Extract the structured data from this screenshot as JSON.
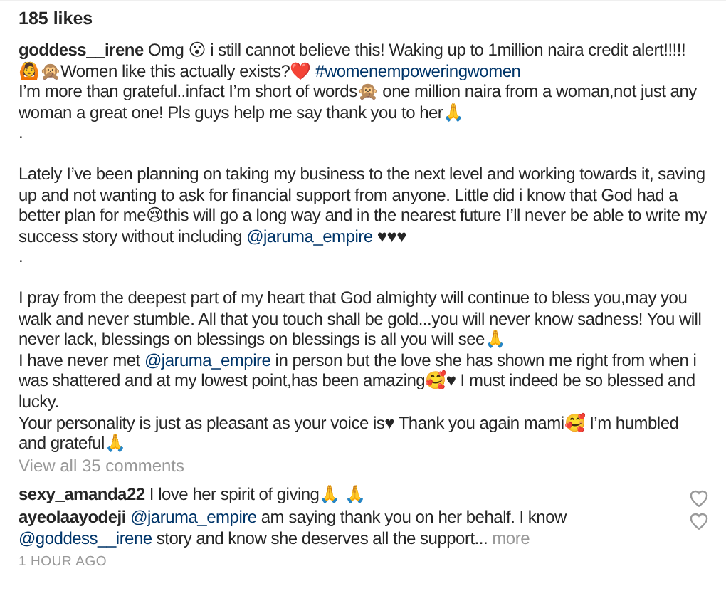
{
  "likes": "185 likes",
  "caption_blocks": [
    [
      {
        "segments": [
          {
            "kind": "username",
            "text": "goddess__irene"
          },
          {
            "kind": "text",
            "text": "Omg 😮 i still cannot believe this! Waking up to 1million naira credit alert!!!!! 🙆🙊Women like this actually exists?❤️ "
          },
          {
            "kind": "hashtag",
            "text": "#womenempoweringwomen"
          }
        ]
      },
      {
        "segments": [
          {
            "kind": "text",
            "text": "I’m more than grateful..infact I’m short of words🙊 one million naira from a woman,not just any woman a great one! Pls guys help me say thank you to her🙏"
          }
        ]
      },
      {
        "segments": [
          {
            "kind": "text",
            "text": "."
          }
        ]
      }
    ],
    [
      {
        "segments": [
          {
            "kind": "text",
            "text": "Lately I’ve been planning on taking my business to the next level and working towards it, saving up and not wanting to ask for financial support from anyone. Little did i know that God had a better plan for me😢this will go a long way and in the nearest future I’ll never be able to write my success story without including "
          },
          {
            "kind": "mention",
            "text": "@jaruma_empire"
          },
          {
            "kind": "text",
            "text": " ♥♥♥"
          }
        ]
      },
      {
        "segments": [
          {
            "kind": "text",
            "text": "."
          }
        ]
      }
    ],
    [
      {
        "segments": [
          {
            "kind": "text",
            "text": "I pray from the deepest part of my heart that God almighty will continue to bless you,may you walk and never stumble. All that you touch shall be gold...you will never know sadness! You will never lack, blessings on blessings on blessings is all you will see🙏"
          }
        ]
      },
      {
        "segments": [
          {
            "kind": "text",
            "text": "I have never met "
          },
          {
            "kind": "mention",
            "text": "@jaruma_empire"
          },
          {
            "kind": "text",
            "text": " in person but the love she has shown me right from when i was shattered and at my lowest point,has been amazing🥰♥ I must indeed be so blessed and lucky."
          }
        ]
      },
      {
        "segments": [
          {
            "kind": "text",
            "text": "Your personality is just as pleasant as your voice is♥ Thank you again mami🥰 I’m humbled and grateful🙏"
          }
        ]
      }
    ]
  ],
  "view_all": "View all 35 comments",
  "comments": [
    {
      "segments": [
        {
          "kind": "username",
          "text": "sexy_amanda22"
        },
        {
          "kind": "text",
          "text": "I love her spirit of giving🙏 🙏"
        }
      ],
      "liked": false
    },
    {
      "segments": [
        {
          "kind": "username",
          "text": "ayeolaayodeji"
        },
        {
          "kind": "mention",
          "text": "@jaruma_empire"
        },
        {
          "kind": "text",
          "text": " am saying thank you on her behalf. I know "
        },
        {
          "kind": "mention",
          "text": "@goddess__irene"
        },
        {
          "kind": "text",
          "text": " story and know she deserves all the support... "
        },
        {
          "kind": "more",
          "text": "more"
        }
      ],
      "liked": false
    }
  ],
  "timestamp": "1 HOUR AGO"
}
